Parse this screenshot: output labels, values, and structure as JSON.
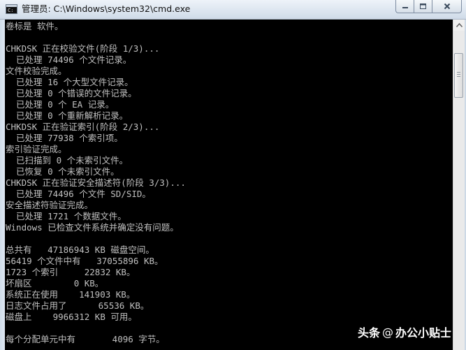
{
  "window": {
    "title": "管理员: C:\\Windows\\system32\\cmd.exe",
    "icon": "cmd-console-icon",
    "controls": {
      "minimize_icon": "minimize-icon",
      "maximize_icon": "maximize-icon",
      "close_icon": "close-icon"
    }
  },
  "console": {
    "lines": [
      "卷标是 软件。",
      "",
      "CHKDSK 正在校验文件(阶段 1/3)...",
      "  已处理 74496 个文件记录。",
      "文件校验完成。",
      "  已处理 16 个大型文件记录。",
      "  已处理 0 个错误的文件记录。",
      "  已处理 0 个 EA 记录。",
      "  已处理 0 个重新解析记录。",
      "CHKDSK 正在验证索引(阶段 2/3)...",
      "  已处理 77938 个索引项。",
      "索引验证完成。",
      "  已扫描到 0 个未索引文件。",
      "  已恢复 0 个未索引文件。",
      "CHKDSK 正在验证安全描述符(阶段 3/3)...",
      "  已处理 74496 个文件 SD/SID。",
      "安全描述符验证完成。",
      "  已处理 1721 个数据文件。",
      "Windows 已检查文件系统并确定没有问题。",
      "",
      "总共有   47186943 KB 磁盘空间。",
      "56419 个文件中有   37055896 KB。",
      "1723 个索引     22832 KB。",
      "坏扇区        0 KB。",
      "系统正在使用    141903 KB。",
      "日志文件占用了      65536 KB。",
      "磁盘上    9966312 KB 可用。",
      "",
      "每个分配单元中有       4096 字节。"
    ]
  },
  "watermark": {
    "brand": "头条",
    "separator": "@",
    "account": "办公小贴士"
  },
  "colors": {
    "console_bg": "#000000",
    "console_text": "#c0c0c0",
    "titlebar": "#dde6f0"
  }
}
